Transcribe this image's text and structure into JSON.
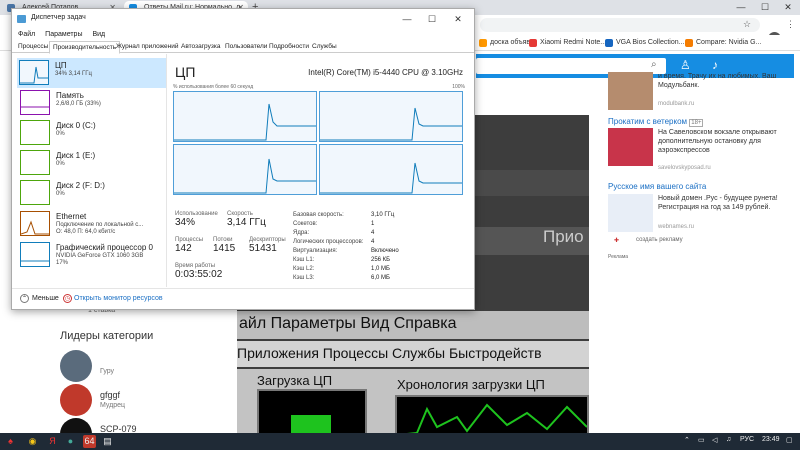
{
  "browser": {
    "tabs": [
      {
        "label": "Алексей Потапов",
        "favicon_color": "#4a76a8"
      },
      {
        "label": "Ответы Mail.ru: Нормально, л...",
        "favicon_color": "#168de2"
      }
    ],
    "new_tab": "+",
    "bookmarks": [
      {
        "label": "доска объяв...",
        "color": "#ff9800"
      },
      {
        "label": "Xiaomi Redmi Note...",
        "color": "#e53935"
      },
      {
        "label": "VGA Bios Collection...",
        "color": "#1565c0"
      },
      {
        "label": "Compare: Nvidia G...",
        "color": "#f57c00"
      }
    ],
    "window_controls": {
      "min": "—",
      "max": "☐",
      "close": "✕"
    }
  },
  "taskmgr": {
    "title": "Диспетчер задач",
    "menu": [
      "Файл",
      "Параметры",
      "Вид"
    ],
    "tabs": [
      "Процессы",
      "Производительность",
      "Журнал приложений",
      "Автозагрузка",
      "Пользователи",
      "Подробности",
      "Службы"
    ],
    "resources": [
      {
        "name": "ЦП",
        "sub": "34%  3,14 ГГц",
        "color": "#117dbb"
      },
      {
        "name": "Память",
        "sub": "2,6/8,0 ГБ (33%)",
        "color": "#8b12ae"
      },
      {
        "name": "Диск 0 (C:)",
        "sub": "0%",
        "color": "#4da60c"
      },
      {
        "name": "Диск 1 (E:)",
        "sub": "0%",
        "color": "#4da60c"
      },
      {
        "name": "Диск 2 (F: D:)",
        "sub": "0%",
        "color": "#4da60c"
      },
      {
        "name": "Ethernet",
        "sub": "Подключение по локальной с...",
        "sub2": "О: 48,0  П: 64,0 кбит/с",
        "color": "#a74f01"
      },
      {
        "name": "Графический процессор 0",
        "sub": "NVIDIA GeForce GTX 1060 3GB",
        "sub2": "17%",
        "color": "#117dbb"
      }
    ],
    "detail": {
      "heading": "ЦП",
      "cpu_name": "Intel(R) Core(TM) i5-4440 CPU @ 3.10GHz",
      "graph_caption": "% использования более 60 секунд",
      "graph_max": "100%",
      "stats": {
        "usage_label": "Использование",
        "usage": "34%",
        "speed_label": "Скорость",
        "speed": "3,14 ГГц",
        "proc_label": "Процессы",
        "proc": "142",
        "threads_label": "Потоки",
        "threads": "1415",
        "handles_label": "Дескрипторы",
        "handles": "51431",
        "uptime_label": "Время работы",
        "uptime": "0:03:55:02"
      },
      "props": [
        {
          "k": "Базовая скорость:",
          "v": "3,10 ГГц"
        },
        {
          "k": "Сокетов:",
          "v": "1"
        },
        {
          "k": "Ядра:",
          "v": "4"
        },
        {
          "k": "Логических процессоров:",
          "v": "4"
        },
        {
          "k": "Виртуализация:",
          "v": "Включено"
        },
        {
          "k": "Кэш L1:",
          "v": "256 КБ"
        },
        {
          "k": "Кэш L2:",
          "v": "1,0 МБ"
        },
        {
          "k": "Кэш L3:",
          "v": "6,0 МБ"
        }
      ]
    },
    "footer": {
      "less": "Меньше",
      "monitor": "Открыть монитор ресурсов"
    }
  },
  "photo": {
    "disk_text": "ь = 13.36 ГБ",
    "prio_text": "Прио",
    "menu_text": "айл   Параметры   Вид   Справка",
    "tabs_text": "Приложения  Процессы  Службы  Быстродейств",
    "cpu_load": "Загрузка ЦП",
    "cpu_history": "Хронология загрузки ЦП"
  },
  "page": {
    "rating": "1 ставка",
    "leaders_heading": "Лидеры категории",
    "leaders": [
      {
        "name": "",
        "rank": "Гуру",
        "color": "#5a6b7c"
      },
      {
        "name": "gfggf",
        "rank": "Мудрец",
        "color": "#c0392b"
      },
      {
        "name": "SCP-079",
        "rank": "",
        "color": "#111111"
      }
    ]
  },
  "sidebar": {
    "ad1": {
      "text": "и время. Трачу их на любимых. Ваш Модульбанк.",
      "src": "modulbank.ru"
    },
    "ad2": {
      "heading": "Прокатим с ветерком",
      "age": "18+",
      "text": "На Савеловском вокзале открывают дополнительную остановку для аэроэкспрессов",
      "src": "savelovskyposad.ru"
    },
    "ad3": {
      "heading": "Русское имя вашего сайта",
      "text": "Новый домен .Рус - будущее рунета! Регистрация на год за 149 рублей.",
      "src": "webnames.ru",
      "create": "создать рекламу"
    },
    "ads_label": "Реклама"
  },
  "taskbar": {
    "lang": "РУС",
    "time": "23:49"
  }
}
